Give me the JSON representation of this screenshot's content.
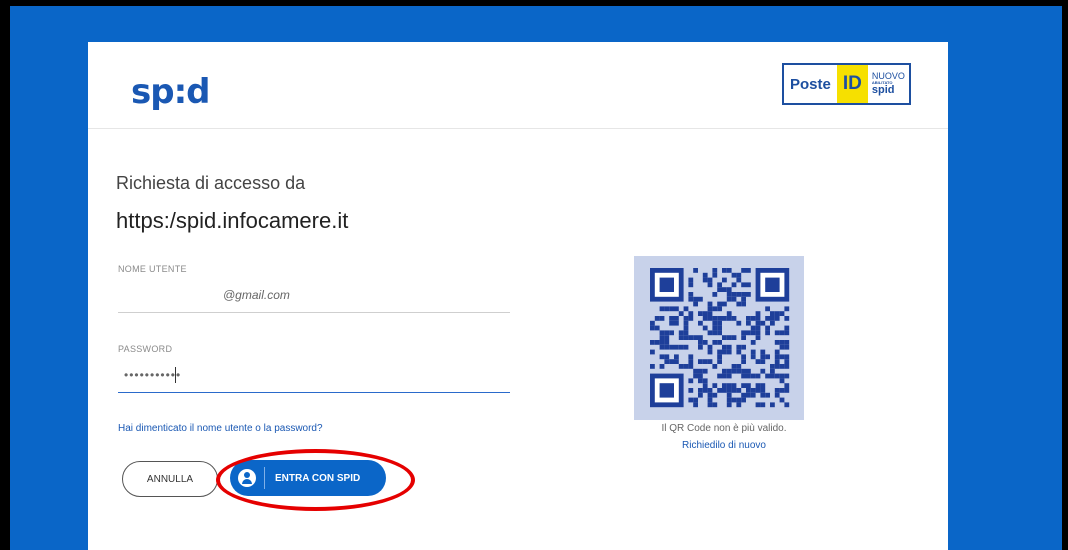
{
  "header": {
    "logo_text": "sp:d",
    "poste_text": "Poste",
    "id_text": "ID",
    "nuovo_text": "NUOVO",
    "abilitato_text": "ABILITATO",
    "mini_spid_text": "spid"
  },
  "request": {
    "label": "Richiesta di accesso da",
    "url": "https:/spid.infocamere.it"
  },
  "login": {
    "username_label": "NOME UTENTE",
    "username_value": "@gmail.com",
    "password_label": "PASSWORD",
    "password_value": "•••••••••••",
    "forgot_link": "Hai dimenticato il nome utente o la password?"
  },
  "buttons": {
    "cancel_label": "ANNULLA",
    "enter_label": "ENTRA CON SPID"
  },
  "qr": {
    "message": "Il QR Code non è più valido.",
    "retry_link": "Richiedilo di nuovo"
  },
  "colors": {
    "background": "#0a66c8",
    "brand_blue": "#1a58b3",
    "highlight_red": "#e50000",
    "poste_yellow": "#f6e000"
  }
}
